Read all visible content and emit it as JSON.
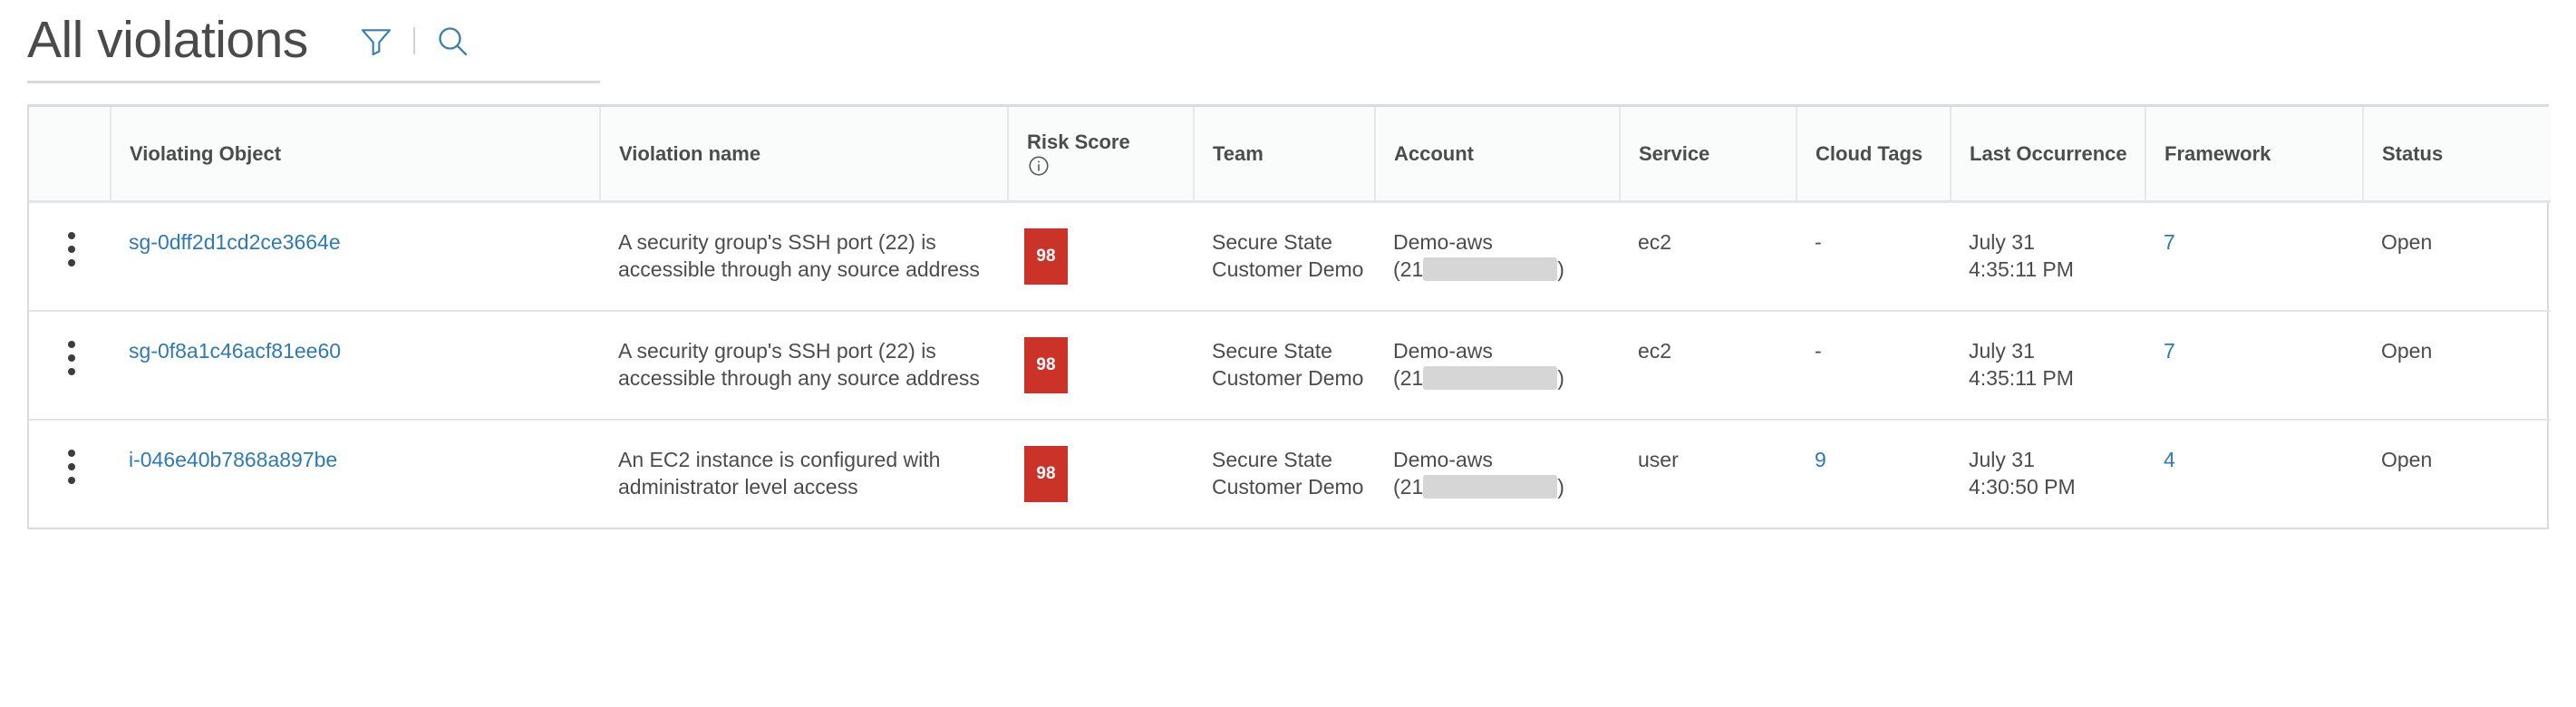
{
  "header": {
    "title": "All violations",
    "filter_icon": "filter-funnel-icon",
    "search_icon": "search-icon"
  },
  "table": {
    "columns": [
      {
        "key": "menu",
        "label": ""
      },
      {
        "key": "object",
        "label": "Violating Object"
      },
      {
        "key": "violation",
        "label": "Violation name"
      },
      {
        "key": "risk",
        "label": "Risk Score",
        "info_icon": "info-circle-icon"
      },
      {
        "key": "team",
        "label": "Team"
      },
      {
        "key": "account",
        "label": "Account"
      },
      {
        "key": "service",
        "label": "Service"
      },
      {
        "key": "tags",
        "label": "Cloud Tags"
      },
      {
        "key": "last",
        "label": "Last Occurrence"
      },
      {
        "key": "framework",
        "label": "Framework"
      },
      {
        "key": "status",
        "label": "Status"
      }
    ],
    "rows": [
      {
        "object": "sg-0dff2d1cd2ce3664e",
        "violation": "A security group's SSH port (22) is accessible through any source address",
        "risk_score": "98",
        "team": "Secure State Customer Demo",
        "account_prefix": "Demo-aws",
        "account_id_visible": "(21",
        "account_id_suffix": ")",
        "service": "ec2",
        "cloud_tags": "-",
        "cloud_tags_is_link": false,
        "last_occurrence_date": "July 31",
        "last_occurrence_time": "4:35:11 PM",
        "framework": "7",
        "status": "Open"
      },
      {
        "object": "sg-0f8a1c46acf81ee60",
        "violation": "A security group's SSH port (22) is accessible through any source address",
        "risk_score": "98",
        "team": "Secure State Customer Demo",
        "account_prefix": "Demo-aws",
        "account_id_visible": "(21",
        "account_id_suffix": ")",
        "service": "ec2",
        "cloud_tags": "-",
        "cloud_tags_is_link": false,
        "last_occurrence_date": "July 31",
        "last_occurrence_time": "4:35:11 PM",
        "framework": "7",
        "status": "Open"
      },
      {
        "object": "i-046e40b7868a897be",
        "violation": "An EC2 instance is configured with administrator level access",
        "risk_score": "98",
        "team": "Secure State Customer Demo",
        "account_prefix": "Demo-aws",
        "account_id_visible": "(21",
        "account_id_suffix": ")",
        "service": "user",
        "cloud_tags": "9",
        "cloud_tags_is_link": true,
        "last_occurrence_date": "July 31",
        "last_occurrence_time": "4:30:50 PM",
        "framework": "4",
        "status": "Open"
      }
    ]
  },
  "colors": {
    "link": "#2d7ab5",
    "risk_badge": "#cc3328",
    "icon_blue": "#3a7fad",
    "text": "#4c4c4c",
    "border": "#e3e6e8"
  }
}
